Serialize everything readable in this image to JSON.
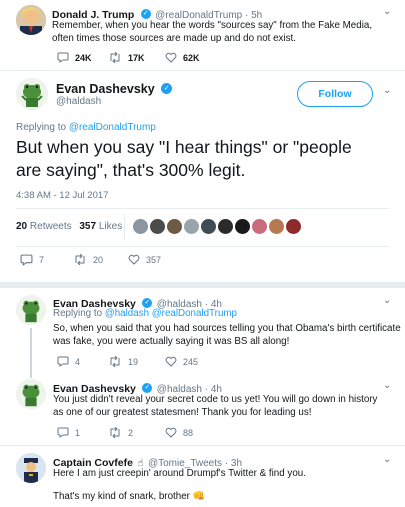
{
  "top_tweet": {
    "name": "Donald J. Trump",
    "handle": "@realDonaldTrump · 5h",
    "text_1": "Remember, when you hear the words \"sources say\" from the Fake Media,",
    "text_2": "often times those sources are made up and do not exist.",
    "replies": "24K",
    "retweets": "17K",
    "likes": "62K"
  },
  "main_tweet": {
    "name": "Evan Dashevsky",
    "handle": "@haldash",
    "follow_label": "Follow",
    "replying_prefix": "Replying to ",
    "replying_handle": "@realDonaldTrump",
    "text_1": "But when you say \"I hear things\" or \"people",
    "text_2": "are saying\", that's 300% legit.",
    "timestamp": "4:38 AM - 12 Jul 2017",
    "retweet_count": "20",
    "retweet_label": "Retweets",
    "like_count": "357",
    "like_label": "Likes",
    "replies": "7",
    "retweets": "20",
    "likes": "357"
  },
  "replies": [
    {
      "name": "Evan Dashevsky",
      "handle": "@haldash · 4h",
      "replying_prefix": "Replying to ",
      "replying_handles": "@haldash @realDonaldTrump",
      "text_1": "So, when you said that you had sources telling you that Obama's birth certificate",
      "text_2": "was fake, you were actually saying it was BS all along!",
      "replies": "4",
      "retweets": "19",
      "likes": "245"
    },
    {
      "name": "Evan Dashevsky",
      "handle": "@haldash · 4h",
      "text_1": "You just didn't reveal your secret code to us yet! You will go down in history",
      "text_2": "as one of our greatest statesmen! Thank you for leading us!",
      "replies": "1",
      "retweets": "2",
      "likes": "88"
    },
    {
      "name": "Captain Covfefe",
      "name_emoji": "☝",
      "handle": "@Tomie_Tweets · 3h",
      "text_1": "Here I am just creepin' around Drumpf's Twitter & find you.",
      "text_2": "That's my kind of snark, brother",
      "text_2_emoji": "👊"
    }
  ],
  "colors": {
    "accent": "#1da1f2",
    "muted": "#657786",
    "divider": "#e6ecf0"
  }
}
